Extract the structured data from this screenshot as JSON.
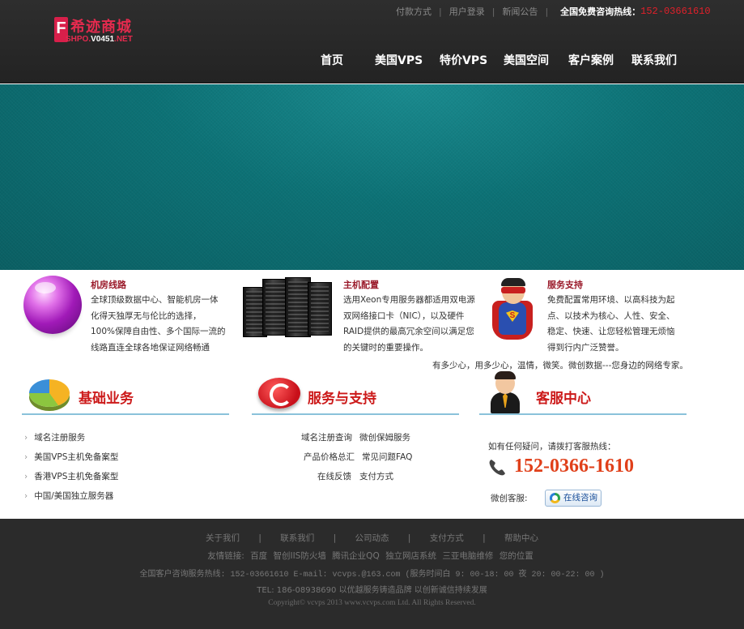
{
  "header": {
    "logo": {
      "cn": "希迹商城",
      "en_prefix": "SHPO.",
      "en_mid": "V0451",
      "en_suffix": ".NET"
    },
    "toplinks": [
      "付款方式",
      "用户登录",
      "新闻公告"
    ],
    "toplink_sep": "|",
    "hotline_label": "全国免费咨询热线：",
    "hotline_number": "152-03661610",
    "nav": [
      "首页",
      "美国VPS",
      "特价VPS",
      "美国空间",
      "客户案例",
      "联系我们"
    ]
  },
  "features": [
    {
      "title": "机房线路",
      "lines": [
        "全球顶级数据中心、智能机房一体",
        "化得天独厚无与伦比的选择，",
        "100%保障自由性、多个国际一流的",
        "线路直连全球各地保证网络畅通"
      ]
    },
    {
      "title": "主机配置",
      "lines": [
        "选用Xeon专用服务器都适用双电源",
        "双网络接口卡（NIC），以及硬件",
        "RAID提供的最高冗余空间以满足您",
        "的关键时的重要操作。"
      ]
    },
    {
      "title": "服务支持",
      "lines": [
        "免费配置常用环境、以高科技为起",
        "点、以技术为核心、人性、安全、",
        "稳定、快速、让您轻松管理无烦恼",
        "得到行内广泛赞誉。"
      ]
    }
  ],
  "slogan": "有多少心，用多少心，温情，微笑。微创数据---您身边的网络专家。",
  "sections": {
    "basic": {
      "title": "基础业务",
      "items": [
        "域名注册服务",
        "美国VPS主机免备案型",
        "香港VPS主机免备案型",
        "中国/美国独立服务器"
      ]
    },
    "service": {
      "title": "服务与支持",
      "row1": [
        "域名注册查询",
        "微创保姆服务"
      ],
      "row2": [
        "产品价格总汇",
        "常见问题FAQ"
      ],
      "row3": [
        "在线反馈",
        "支付方式"
      ]
    },
    "cs": {
      "title": "客服中心",
      "prompt": "如有任何疑问，请拨打客服热线：",
      "phone": "152-0366-1610",
      "weichuang_label": "微创客服:",
      "online_button": "在线咨询"
    }
  },
  "footer": {
    "nav": [
      "关于我们",
      "联系我们",
      "公司动态",
      "支付方式",
      "帮助中心"
    ],
    "nav_sep": "|",
    "friend_links_label": "友情链接:",
    "friend_links": [
      "百度",
      "智创IIS防火墙",
      "腾讯企业QQ",
      "独立网店系统",
      "三亚电脑维修",
      "您的位置"
    ],
    "hotline_line": "全国客户咨询服务热线: 152-03661610 E-mail: vcvps.@163.com (服务时间白 9: 00-18: 00 夜 20: 00-22: 00 )",
    "tel_line": "TEL: 186-08938690 以优越服务铸造品牌 以创新诚信持续发展",
    "copyright": "Copyright© vcvps 2013 www.vcvps.com Ltd. All Rights Reserved."
  }
}
